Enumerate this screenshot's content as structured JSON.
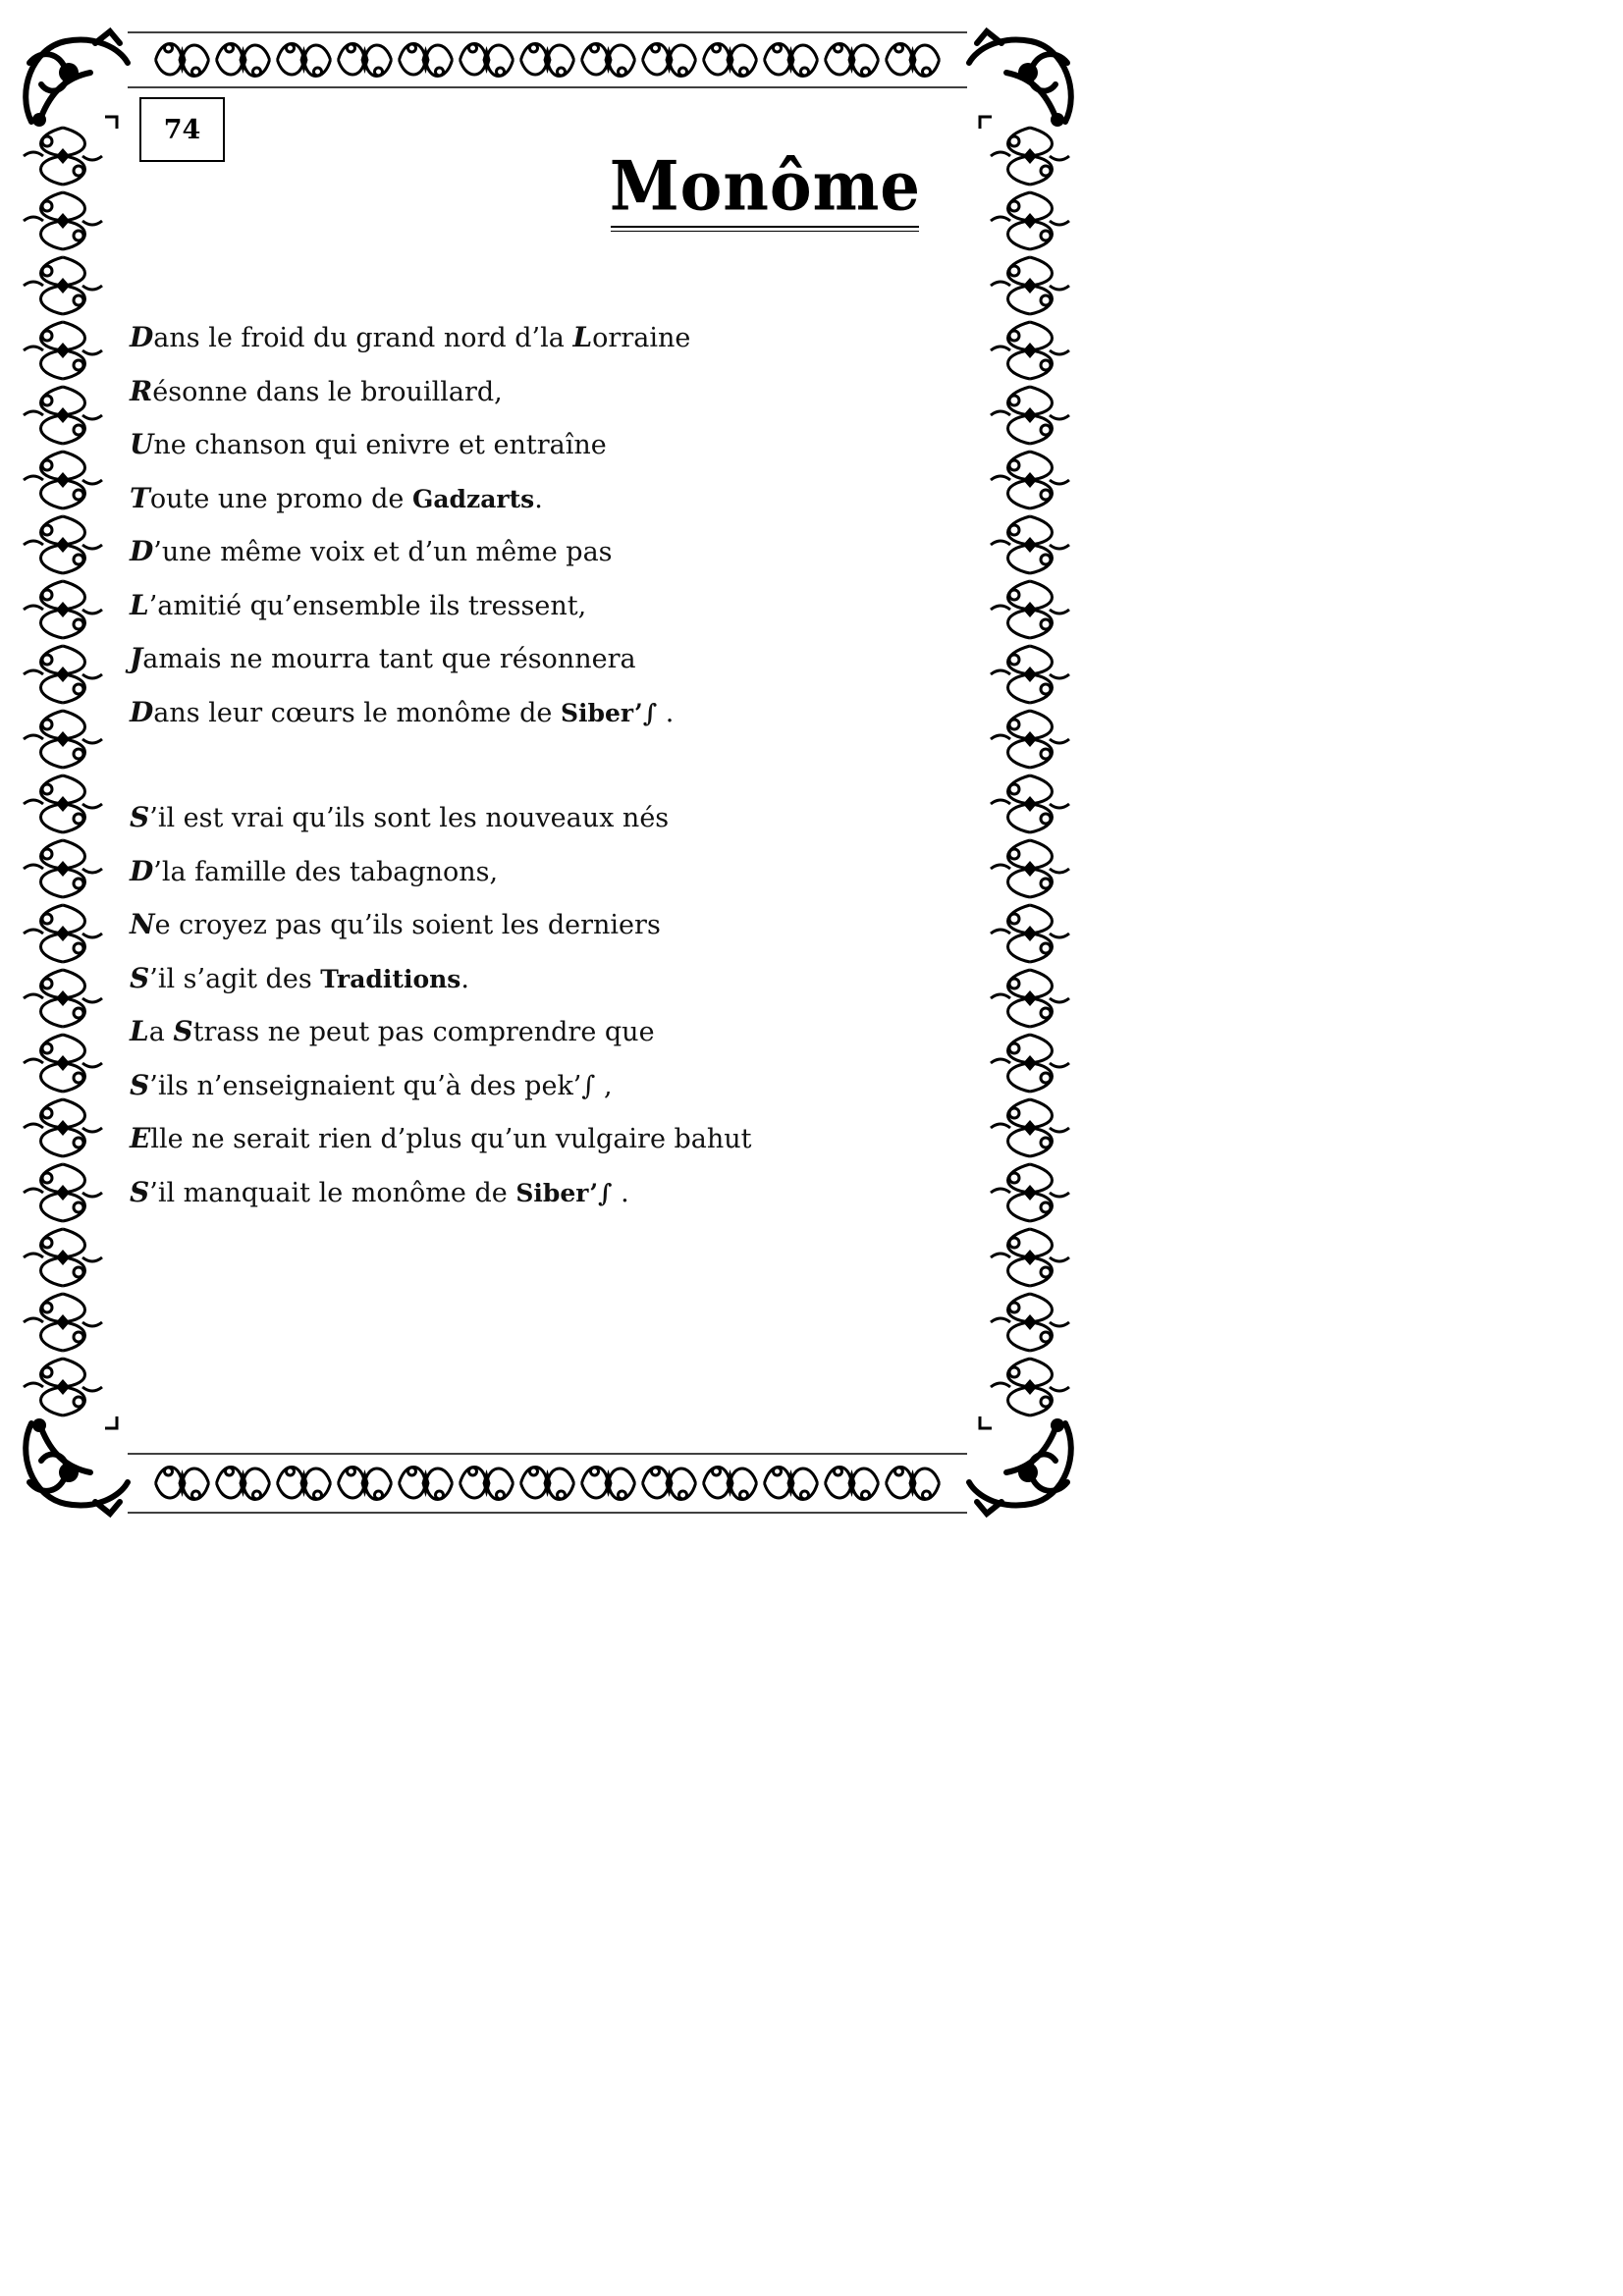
{
  "page": {
    "number": "74",
    "title": "Monôme"
  },
  "stanzas": [
    {
      "lines": [
        [
          {
            "t": "D",
            "s": "initial"
          },
          {
            "t": "ans le froid du grand nord d’la "
          },
          {
            "t": "L",
            "s": "initial"
          },
          {
            "t": "orraine"
          }
        ],
        [
          {
            "t": "R",
            "s": "initial"
          },
          {
            "t": "ésonne dans le brouillard,"
          }
        ],
        [
          {
            "t": "U",
            "s": "initial"
          },
          {
            "t": "ne chanson qui enivre et entraîne"
          }
        ],
        [
          {
            "t": "T",
            "s": "initial"
          },
          {
            "t": "oute une promo de "
          },
          {
            "t": "Gadzarts",
            "s": "gothic"
          },
          {
            "t": "."
          }
        ],
        [
          {
            "t": "D",
            "s": "initial"
          },
          {
            "t": "’une même voix et d’un même pas"
          }
        ],
        [
          {
            "t": "L",
            "s": "initial"
          },
          {
            "t": "’amitié qu’ensemble ils tressent,"
          }
        ],
        [
          {
            "t": "J",
            "s": "initial"
          },
          {
            "t": "amais ne mourra tant que résonnera"
          }
        ],
        [
          {
            "t": "D",
            "s": "initial"
          },
          {
            "t": "ans leur cœurs le monôme de "
          },
          {
            "t": "Siber’∫",
            "s": "gothic"
          },
          {
            "t": " ."
          }
        ]
      ]
    },
    {
      "lines": [
        [
          {
            "t": "S",
            "s": "initial"
          },
          {
            "t": "’il est vrai qu’ils sont les nouveaux nés"
          }
        ],
        [
          {
            "t": "D",
            "s": "initial"
          },
          {
            "t": "’la famille des tabagnons,"
          }
        ],
        [
          {
            "t": "N",
            "s": "initial"
          },
          {
            "t": "e croyez pas qu’ils soient les derniers"
          }
        ],
        [
          {
            "t": "S",
            "s": "initial"
          },
          {
            "t": "’il s’agit des "
          },
          {
            "t": "Traditions",
            "s": "gothic"
          },
          {
            "t": "."
          }
        ],
        [
          {
            "t": "L",
            "s": "initial"
          },
          {
            "t": "a "
          },
          {
            "t": "S",
            "s": "initial"
          },
          {
            "t": "trass ne peut pas comprendre que"
          }
        ],
        [
          {
            "t": "S",
            "s": "initial"
          },
          {
            "t": "’ils n’enseignaient qu’à des pek’∫ ,"
          }
        ],
        [
          {
            "t": "E",
            "s": "initial"
          },
          {
            "t": "lle ne serait rien d’plus qu’un vulgaire bahut"
          }
        ],
        [
          {
            "t": "S",
            "s": "initial"
          },
          {
            "t": "’il manquait le monôme de "
          },
          {
            "t": "Siber’∫",
            "s": "gothic"
          },
          {
            "t": " ."
          }
        ]
      ]
    }
  ],
  "decor": {
    "border_icon": "ornamental-scroll-border",
    "ink_color": "#000000"
  }
}
